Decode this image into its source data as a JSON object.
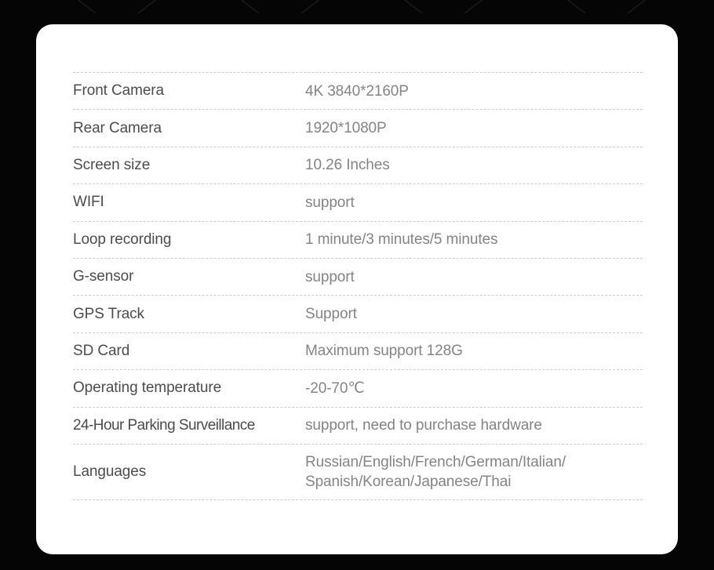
{
  "card": {
    "background_color": "#ffffff",
    "page_background_color": "#050505",
    "label_color": "#4c4c4c",
    "value_color": "#848484",
    "divider_color": "#cccccc"
  },
  "spec_table": {
    "rows": [
      {
        "label": "Front Camera",
        "value": "4K 3840*2160P"
      },
      {
        "label": "Rear Camera",
        "value": "1920*1080P"
      },
      {
        "label": "Screen size",
        "value": "10.26 Inches"
      },
      {
        "label": "WIFI",
        "value": "support"
      },
      {
        "label": "Loop recording",
        "value": "1 minute/3 minutes/5 minutes"
      },
      {
        "label": "G-sensor",
        "value": "support"
      },
      {
        "label": "GPS Track",
        "value": "Support"
      },
      {
        "label": "SD Card",
        "value": "Maximum support 128G"
      },
      {
        "label": "Operating temperature",
        "value": "-20-70℃"
      },
      {
        "label": "24-Hour Parking Surveillance",
        "value": "support, need to purchase hardware"
      },
      {
        "label": "Languages",
        "value": "Russian/English/French/German/Italian/\nSpanish/Korean/Japanese/Thai"
      }
    ]
  }
}
